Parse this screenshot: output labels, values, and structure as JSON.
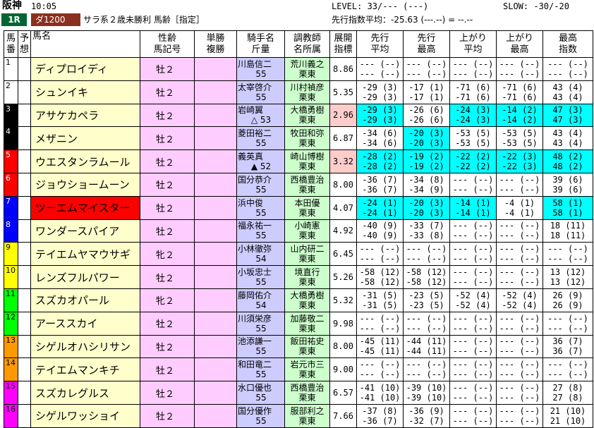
{
  "header": {
    "venue": "阪神",
    "time": "10:05",
    "race": "1R",
    "course": "ダ1200",
    "condition": "サラ系２歳未勝利 馬齢［指定］",
    "level": "LEVEL:  33/---  (---)",
    "slow": "SLOW: -30/-20",
    "avg": "先行指数平均：-25.63   (---.--) = --.--"
  },
  "columns": {
    "num": "馬番",
    "yoso": "予想",
    "name": "馬名",
    "sex": "性齢馬記号",
    "odds": "単勝複勝",
    "jockey": "騎手名斤量",
    "trainer": "調教師名所属",
    "index": "展開指標",
    "s_avg": "先行平均",
    "s_max": "先行最高",
    "a_avg": "上がり平均",
    "a_max": "上がり最高",
    "best": "最高指数"
  },
  "colors": {
    "frame1": "#ffffff",
    "frame2": "#ffffff",
    "frame3": "#000000",
    "frame4": "#000000",
    "frame5": "#ff0000",
    "frame6": "#ff0000",
    "frame7": "#0000ff",
    "frame8": "#0000ff",
    "frame9": "#ffff00",
    "frame10": "#ffff00",
    "frame11": "#00ff00",
    "frame12": "#00ff00",
    "frame13": "#ff9900",
    "frame14": "#ff9900",
    "frame15": "#ff00ff",
    "frame16": "#ff00ff"
  },
  "rows": [
    {
      "num": "1",
      "fg": "#000",
      "bg": "#ffffff",
      "name": "ディプロイディ",
      "sex": "牡２",
      "jockey": "川島信二",
      "kin": "55",
      "trainer": "荒川義之",
      "aff": "栗東",
      "idx": "8.86",
      "pink": false,
      "s1": "--- (--)",
      "s2": "--- (--)",
      "m1": "--- (--)",
      "m2": "--- (--)",
      "a1": "--- (--)",
      "a2": "--- (--)",
      "x1": "--- (--)",
      "x2": "--- (--)",
      "b1": "--- (--)",
      "b2": "--- (--)",
      "cy": [
        false,
        false,
        false,
        false,
        false
      ]
    },
    {
      "num": "2",
      "fg": "#000",
      "bg": "#ffffff",
      "name": "シュンイキ",
      "sex": "牡２",
      "jockey": "太宰啓介",
      "kin": "55",
      "trainer": "川村禎彦",
      "aff": "栗東",
      "idx": "5.35",
      "pink": false,
      "s1": "-29 (3)",
      "s2": "-29 (3)",
      "m1": "-17 (1)",
      "m2": "-17 (1)",
      "a1": "-71 (6)",
      "a2": "-71 (6)",
      "x1": "-71 (6)",
      "x2": "-71 (6)",
      "b1": "43 (4)",
      "b2": "43 (4)",
      "cy": [
        false,
        false,
        false,
        false,
        false
      ]
    },
    {
      "num": "3",
      "fg": "#fff",
      "bg": "#000000",
      "name": "アサケカペラ",
      "sex": "牡２",
      "jockey": "岩崎翼",
      "kin": "△ 53",
      "trainer": "大橋勇樹",
      "aff": "栗東",
      "idx": "2.96",
      "pink": true,
      "s1": "-29 (3)",
      "s2": "-29 (3)",
      "m1": "-26 (6)",
      "m2": "-26 (6)",
      "a1": "-24 (3)",
      "a2": "-24 (3)",
      "x1": "-14 (2)",
      "x2": "-14 (2)",
      "b1": "47 (3)",
      "b2": "47 (3)",
      "cy": [
        true,
        false,
        true,
        true,
        true
      ]
    },
    {
      "num": "4",
      "fg": "#fff",
      "bg": "#000000",
      "name": "メザニン",
      "sex": "牡２",
      "jockey": "菱田裕二",
      "kin": "55",
      "trainer": "牧田和弥",
      "aff": "栗東",
      "idx": "6.87",
      "pink": false,
      "s1": "-34 (6)",
      "s2": "-34 (6)",
      "m1": "-20 (3)",
      "m2": "-20 (3)",
      "a1": "-53 (5)",
      "a2": "-53 (5)",
      "x1": "-53 (5)",
      "x2": "-53 (5)",
      "b1": "43 (4)",
      "b2": "43 (4)",
      "cy": [
        false,
        true,
        false,
        false,
        false
      ]
    },
    {
      "num": "5",
      "fg": "#fff",
      "bg": "#ff0000",
      "name": "ウエスタンラムール",
      "sex": "牡２",
      "jockey": "義英真",
      "kin": "▲ 52",
      "trainer": "崎山博樹",
      "aff": "栗東",
      "idx": "3.32",
      "pink": true,
      "s1": "-28 (2)",
      "s2": "-28 (2)",
      "m1": "-19 (2)",
      "m2": "-19 (2)",
      "a1": "-22 (2)",
      "a2": "-22 (2)",
      "x1": "-22 (3)",
      "x2": "-22 (3)",
      "b1": "48 (2)",
      "b2": "48 (2)",
      "cy": [
        true,
        true,
        true,
        true,
        true
      ]
    },
    {
      "num": "6",
      "fg": "#fff",
      "bg": "#ff0000",
      "name": "ジョウショームーン",
      "sex": "牡２",
      "jockey": "国分恭介",
      "kin": "55",
      "trainer": "西橋豊治",
      "aff": "栗東",
      "idx": "8.00",
      "pink": false,
      "s1": "-36 (7)",
      "s2": "-36 (7)",
      "m1": "-34 (8)",
      "m2": "-34 (9)",
      "a1": "--- (--)",
      "a2": "--- (--)",
      "x1": "--- (--)",
      "x2": "--- (--)",
      "b1": "39 (6)",
      "b2": "39 (6)",
      "cy": [
        false,
        false,
        false,
        false,
        false
      ]
    },
    {
      "num": "7",
      "fg": "#fff",
      "bg": "#0000ff",
      "name": "ツーエムマイスター",
      "sex": "牡２",
      "jockey": "浜中俊",
      "kin": "55",
      "trainer": "本田優",
      "aff": "栗東",
      "idx": "4.07",
      "pink": false,
      "hl": true,
      "s1": "-24 (1)",
      "s2": "-24 (1)",
      "m1": "-20 (3)",
      "m2": "-20 (3)",
      "a1": "-14 (1)",
      "a2": "-14 (1)",
      "x1": "-4 (1)",
      "x2": "-4 (1)",
      "b1": "58 (1)",
      "b2": "58 (1)",
      "cy": [
        true,
        true,
        true,
        false,
        true
      ]
    },
    {
      "num": "8",
      "fg": "#fff",
      "bg": "#0000ff",
      "name": "ワンダースパイア",
      "sex": "牡２",
      "jockey": "福永祐一",
      "kin": "55",
      "trainer": "小崎憲",
      "aff": "栗東",
      "idx": "4.92",
      "pink": false,
      "s1": "-40 (9)",
      "s2": "-40 (9)",
      "m1": "-33 (7)",
      "m2": "-33 (8)",
      "a1": "--- (--)",
      "a2": "--- (--)",
      "x1": "--- (--)",
      "x2": "--- (--)",
      "b1": "18 (11)",
      "b2": "18 (11)",
      "cy": [
        false,
        false,
        false,
        false,
        false
      ]
    },
    {
      "num": "9",
      "fg": "#000",
      "bg": "#ffff00",
      "name": "テイエムヤマウサギ",
      "sex": "牝２",
      "jockey": "小林徹弥",
      "kin": "54",
      "trainer": "山内研二",
      "aff": "栗東",
      "idx": "6.45",
      "pink": false,
      "s1": "--- (--)",
      "s2": "--- (--)",
      "m1": "--- (--)",
      "m2": "--- (--)",
      "a1": "--- (--)",
      "a2": "--- (--)",
      "x1": "--- (--)",
      "x2": "--- (--)",
      "b1": "--- (--)",
      "b2": "--- (--)",
      "cy": [
        false,
        false,
        false,
        false,
        false
      ]
    },
    {
      "num": "10",
      "fg": "#000",
      "bg": "#ffff00",
      "name": "レンズフルパワー",
      "sex": "牡２",
      "jockey": "小坂忠士",
      "kin": "55",
      "trainer": "境直行",
      "aff": "栗東",
      "idx": "5.26",
      "pink": false,
      "s1": "-58 (12)",
      "s2": "-58 (12)",
      "m1": "-58 (12)",
      "m2": "-58 (12)",
      "a1": "--- (--)",
      "a2": "--- (--)",
      "x1": "--- (--)",
      "x2": "--- (--)",
      "b1": "13 (12)",
      "b2": "13 (12)",
      "cy": [
        false,
        false,
        false,
        false,
        false
      ]
    },
    {
      "num": "11",
      "fg": "#000",
      "bg": "#00ff00",
      "name": "スズカオパール",
      "sex": "牝２",
      "jockey": "藤岡佑介",
      "kin": "54",
      "trainer": "大橋勇樹",
      "aff": "栗東",
      "idx": "5.32",
      "pink": false,
      "s1": "-31 (5)",
      "s2": "-31 (5)",
      "m1": "-23 (5)",
      "m2": "-23 (5)",
      "a1": "-52 (4)",
      "a2": "-52 (4)",
      "x1": "-52 (4)",
      "x2": "-52 (4)",
      "b1": "26 (9)",
      "b2": "26 (9)",
      "cy": [
        false,
        false,
        false,
        false,
        false
      ]
    },
    {
      "num": "12",
      "fg": "#000",
      "bg": "#00ff00",
      "name": "アーススカイ",
      "sex": "牡２",
      "jockey": "川須栄彦",
      "kin": "55",
      "trainer": "加藤敬二",
      "aff": "栗東",
      "idx": "9.98",
      "pink": false,
      "s1": "--- (--)",
      "s2": "--- (--)",
      "m1": "--- (--)",
      "m2": "--- (--)",
      "a1": "--- (--)",
      "a2": "--- (--)",
      "x1": "--- (--)",
      "x2": "--- (--)",
      "b1": "--- (--)",
      "b2": "--- (--)",
      "cy": [
        false,
        false,
        false,
        false,
        false
      ]
    },
    {
      "num": "13",
      "fg": "#000",
      "bg": "#ff9900",
      "name": "シゲルオハシリサン",
      "sex": "牡２",
      "jockey": "池添謙一",
      "kin": "55",
      "trainer": "飯田祐史",
      "aff": "栗東",
      "idx": "8.00",
      "pink": false,
      "s1": "-45 (11)",
      "s2": "-45 (11)",
      "m1": "-44 (11)",
      "m2": "-44 (11)",
      "a1": "--- (--)",
      "a2": "--- (--)",
      "x1": "--- (--)",
      "x2": "--- (--)",
      "b1": "36 (7)",
      "b2": "36 (7)",
      "cy": [
        false,
        false,
        false,
        false,
        false
      ]
    },
    {
      "num": "14",
      "fg": "#000",
      "bg": "#ff9900",
      "name": "テイエムマンキチ",
      "sex": "牡２",
      "jockey": "和田竜二",
      "kin": "55",
      "trainer": "岩元市三",
      "aff": "栗東",
      "idx": "9.00",
      "pink": false,
      "s1": "--- (--)",
      "s2": "--- (--)",
      "m1": "--- (--)",
      "m2": "--- (--)",
      "a1": "--- (--)",
      "a2": "--- (--)",
      "x1": "--- (--)",
      "x2": "--- (--)",
      "b1": "--- (--)",
      "b2": "--- (--)",
      "cy": [
        false,
        false,
        false,
        false,
        false
      ]
    },
    {
      "num": "15",
      "fg": "#000",
      "bg": "#ff00ff",
      "name": "スズカレグルス",
      "sex": "牡２",
      "jockey": "水口優也",
      "kin": "55",
      "trainer": "西橋豊治",
      "aff": "栗東",
      "idx": "6.57",
      "pink": false,
      "s1": "-41 (10)",
      "s2": "-41 (10)",
      "m1": "-39 (10)",
      "m2": "-39 (10)",
      "a1": "--- (--)",
      "a2": "--- (--)",
      "x1": "--- (--)",
      "x2": "--- (--)",
      "b1": "27 (8)",
      "b2": "27 (8)",
      "cy": [
        false,
        false,
        false,
        false,
        false
      ]
    },
    {
      "num": "16",
      "fg": "#000",
      "bg": "#ff00ff",
      "name": "シゲルワッショイ",
      "sex": "牡２",
      "jockey": "国分優作",
      "kin": "55",
      "trainer": "服部利之",
      "aff": "栗東",
      "idx": "7.66",
      "pink": false,
      "s1": "-37 (8)",
      "s2": "-36 (7)",
      "m1": "-36 (9)",
      "m2": "-32 (7)",
      "a1": "--- (--)",
      "a2": "--- (--)",
      "x1": "--- (--)",
      "x2": "--- (--)",
      "b1": "21 (10)",
      "b2": "21 (10)",
      "cy": [
        false,
        false,
        false,
        false,
        false
      ]
    }
  ]
}
